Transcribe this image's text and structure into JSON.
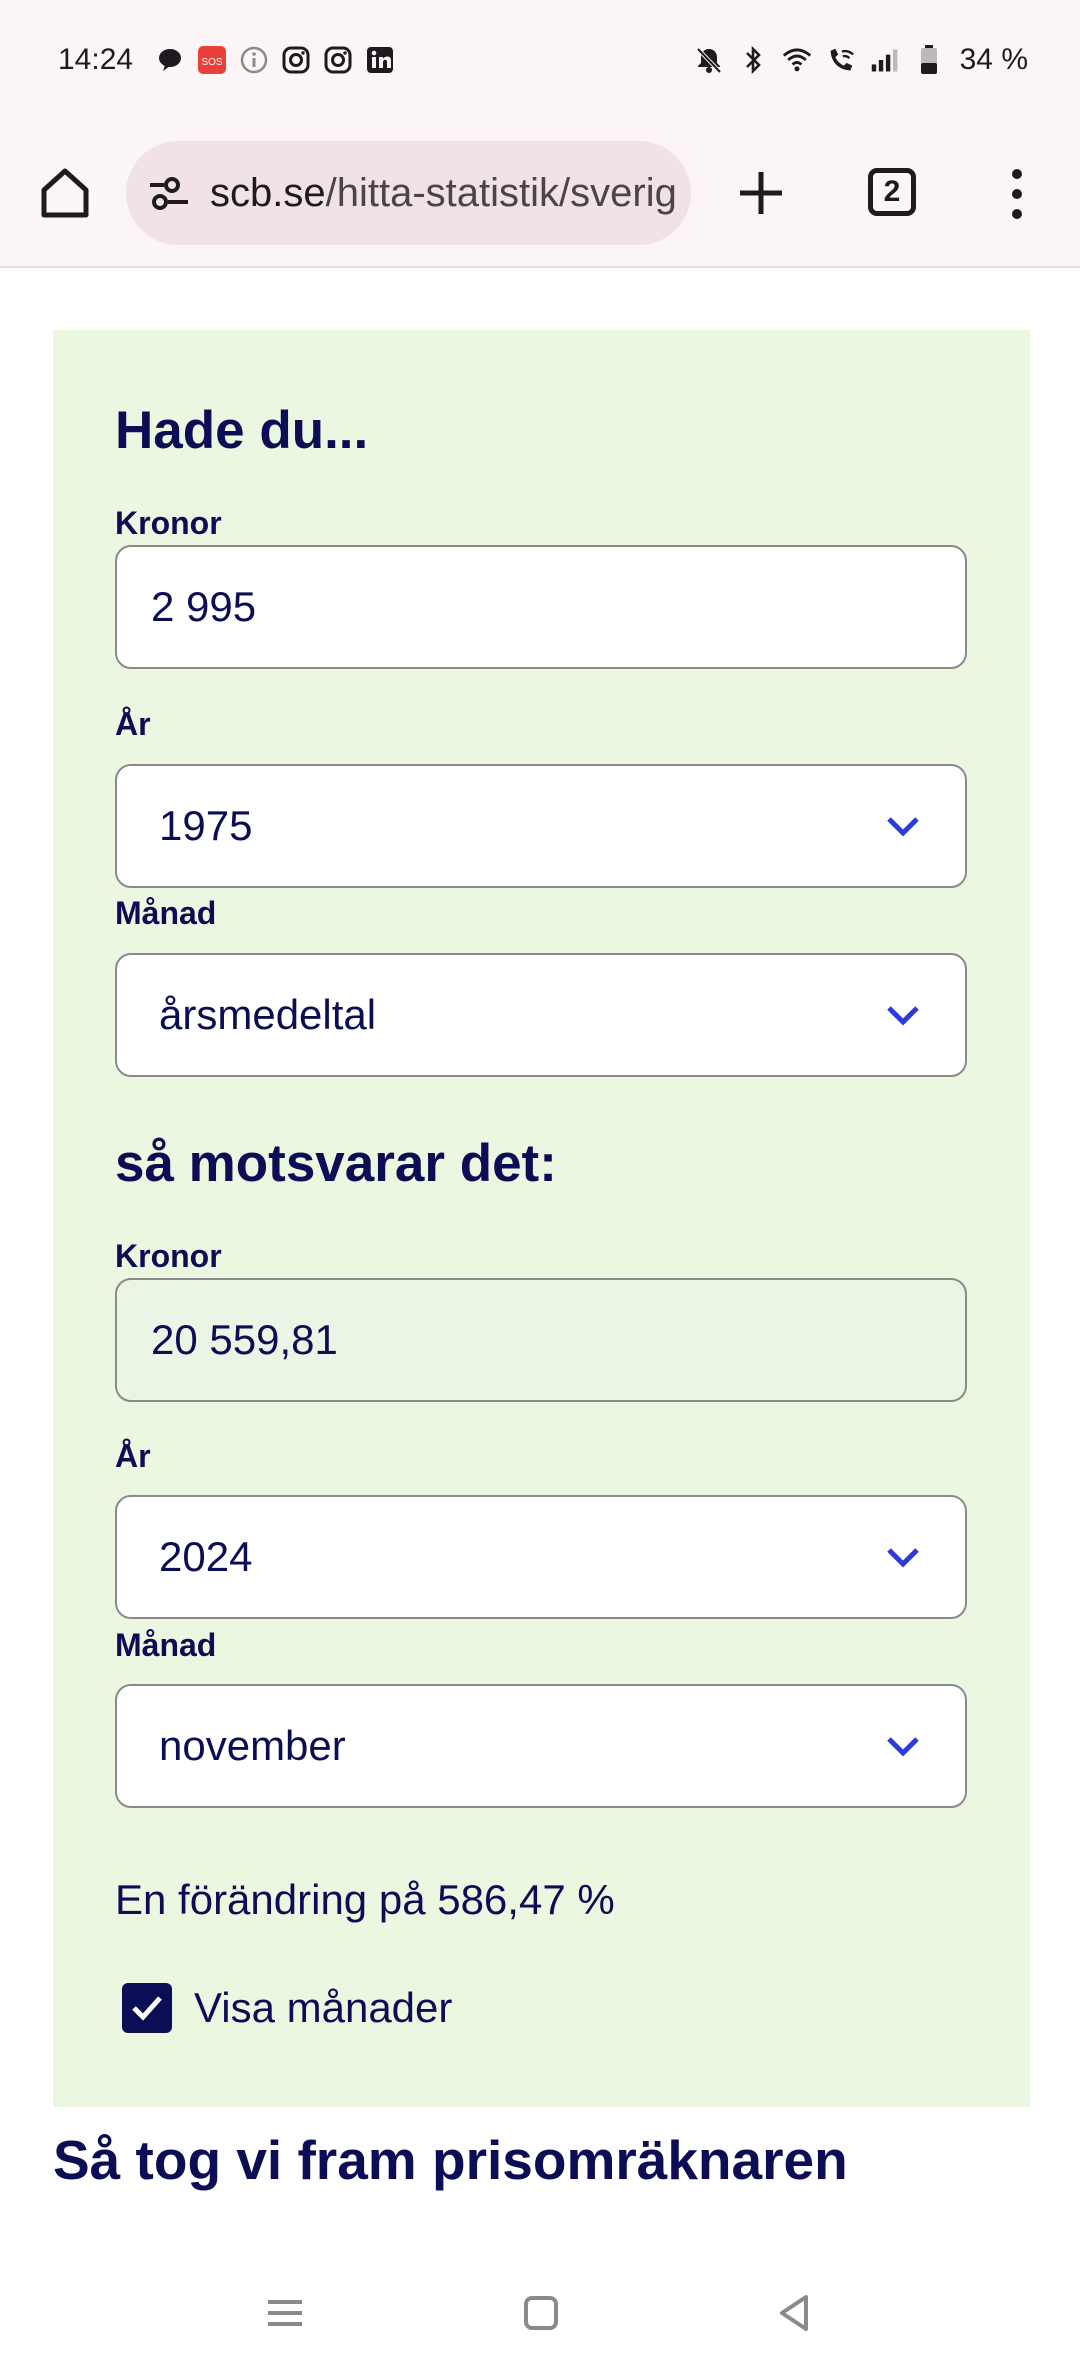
{
  "status_bar": {
    "time": "14:24",
    "battery_text": "34 %",
    "left_icons": [
      "chat-bubble-icon",
      "sos-icon",
      "info-icon",
      "instagram-icon",
      "instagram-icon",
      "linkedin-icon"
    ],
    "right_icons": [
      "mute-bell-icon",
      "bluetooth-icon",
      "wifi-icon",
      "wifi-call-icon",
      "signal-icon",
      "battery-icon"
    ]
  },
  "browser": {
    "url_host": "scb.se",
    "url_path": "/hitta-statistik/sverig",
    "tab_count": "2"
  },
  "calculator": {
    "heading_from": "Hade du...",
    "from_kronor_label": "Kronor",
    "from_kronor_value": "2 995",
    "from_year_label": "År",
    "from_year_value": "1975",
    "from_month_label": "Månad",
    "from_month_value": "årsmedeltal",
    "heading_to": "så motsvarar det:",
    "to_kronor_label": "Kronor",
    "to_kronor_value": "20 559,81",
    "to_year_label": "År",
    "to_year_value": "2024",
    "to_month_label": "Månad",
    "to_month_value": "november",
    "change_text": "En förändring på 586,47 %",
    "show_months_label": "Visa månader",
    "show_months_checked": true
  },
  "section_heading": "Så tog vi fram prisomräknaren",
  "colors": {
    "panel_bg": "#ebf7e1",
    "text_navy": "#0c0e55",
    "chevron_blue": "#2b3bdb",
    "browser_bar": "#fcf5f5"
  }
}
